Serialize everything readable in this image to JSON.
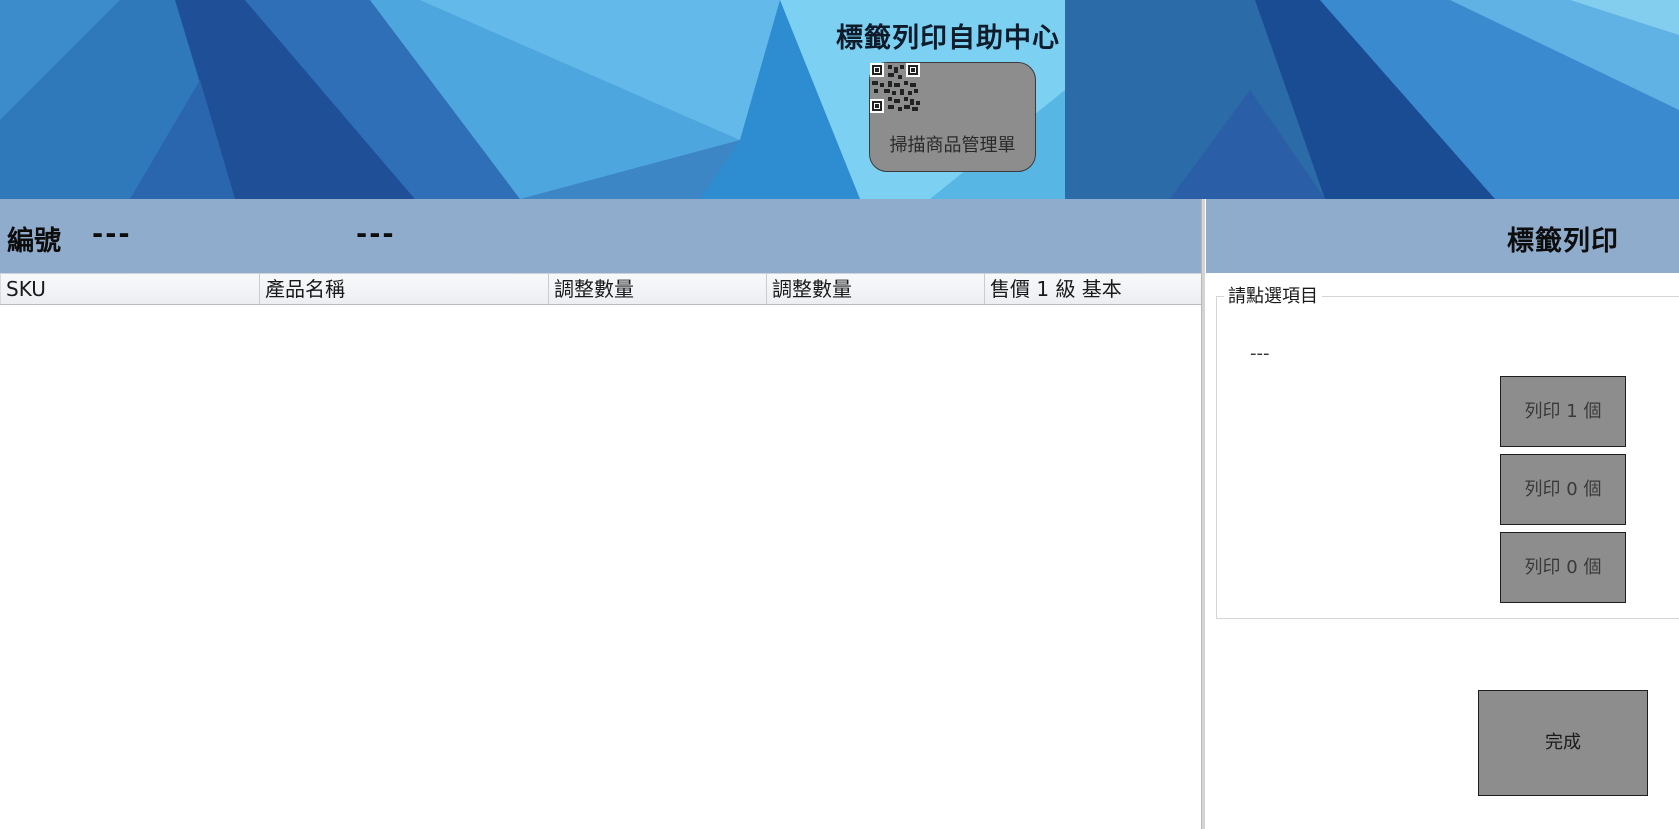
{
  "header": {
    "title": "標籤列印自助中心",
    "scan_button_label": "掃描商品管理單",
    "scan_icon": "qr-code-icon"
  },
  "info_bar": {
    "id_label": "編號",
    "id_value": "---",
    "name_value": "---"
  },
  "grid": {
    "columns": [
      "SKU",
      "產品名稱",
      "調整數量",
      "調整數量",
      "售價 1 級 基本"
    ],
    "rows": []
  },
  "print_panel": {
    "title": "標籤列印",
    "group_label": "請點選項目",
    "selected_item": "---",
    "buttons": [
      "列印 1 個",
      "列印 0 個",
      "列印 0 個"
    ],
    "done_label": "完成"
  },
  "colors": {
    "header_bar": "#8faccc",
    "button_gray": "#8d8d8d",
    "banner_blue": "#3a8fd0"
  }
}
